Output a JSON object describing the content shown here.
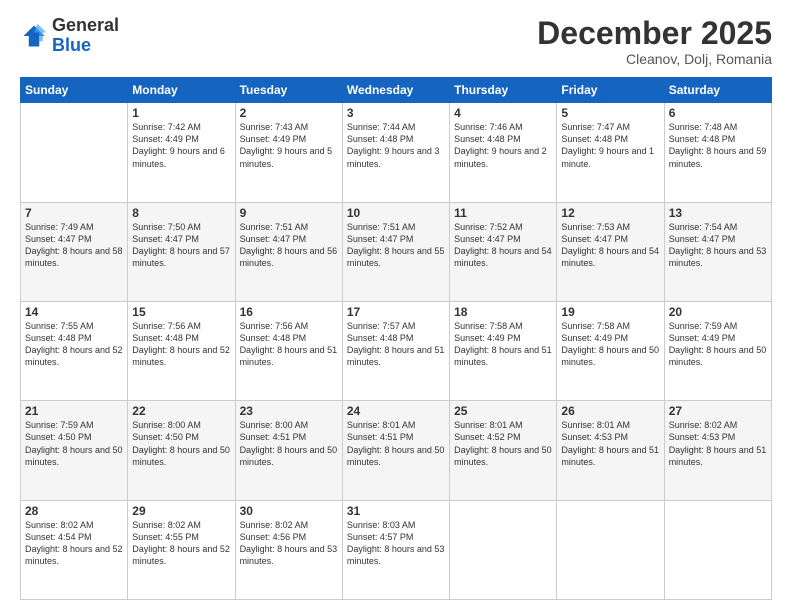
{
  "header": {
    "logo_general": "General",
    "logo_blue": "Blue",
    "month_title": "December 2025",
    "location": "Cleanov, Dolj, Romania"
  },
  "days_of_week": [
    "Sunday",
    "Monday",
    "Tuesday",
    "Wednesday",
    "Thursday",
    "Friday",
    "Saturday"
  ],
  "weeks": [
    [
      {
        "day": "",
        "sunrise": "",
        "sunset": "",
        "daylight": "",
        "empty": true
      },
      {
        "day": "1",
        "sunrise": "Sunrise: 7:42 AM",
        "sunset": "Sunset: 4:49 PM",
        "daylight": "Daylight: 9 hours and 6 minutes."
      },
      {
        "day": "2",
        "sunrise": "Sunrise: 7:43 AM",
        "sunset": "Sunset: 4:49 PM",
        "daylight": "Daylight: 9 hours and 5 minutes."
      },
      {
        "day": "3",
        "sunrise": "Sunrise: 7:44 AM",
        "sunset": "Sunset: 4:48 PM",
        "daylight": "Daylight: 9 hours and 3 minutes."
      },
      {
        "day": "4",
        "sunrise": "Sunrise: 7:46 AM",
        "sunset": "Sunset: 4:48 PM",
        "daylight": "Daylight: 9 hours and 2 minutes."
      },
      {
        "day": "5",
        "sunrise": "Sunrise: 7:47 AM",
        "sunset": "Sunset: 4:48 PM",
        "daylight": "Daylight: 9 hours and 1 minute."
      },
      {
        "day": "6",
        "sunrise": "Sunrise: 7:48 AM",
        "sunset": "Sunset: 4:48 PM",
        "daylight": "Daylight: 8 hours and 59 minutes."
      }
    ],
    [
      {
        "day": "7",
        "sunrise": "Sunrise: 7:49 AM",
        "sunset": "Sunset: 4:47 PM",
        "daylight": "Daylight: 8 hours and 58 minutes."
      },
      {
        "day": "8",
        "sunrise": "Sunrise: 7:50 AM",
        "sunset": "Sunset: 4:47 PM",
        "daylight": "Daylight: 8 hours and 57 minutes."
      },
      {
        "day": "9",
        "sunrise": "Sunrise: 7:51 AM",
        "sunset": "Sunset: 4:47 PM",
        "daylight": "Daylight: 8 hours and 56 minutes."
      },
      {
        "day": "10",
        "sunrise": "Sunrise: 7:51 AM",
        "sunset": "Sunset: 4:47 PM",
        "daylight": "Daylight: 8 hours and 55 minutes."
      },
      {
        "day": "11",
        "sunrise": "Sunrise: 7:52 AM",
        "sunset": "Sunset: 4:47 PM",
        "daylight": "Daylight: 8 hours and 54 minutes."
      },
      {
        "day": "12",
        "sunrise": "Sunrise: 7:53 AM",
        "sunset": "Sunset: 4:47 PM",
        "daylight": "Daylight: 8 hours and 54 minutes."
      },
      {
        "day": "13",
        "sunrise": "Sunrise: 7:54 AM",
        "sunset": "Sunset: 4:47 PM",
        "daylight": "Daylight: 8 hours and 53 minutes."
      }
    ],
    [
      {
        "day": "14",
        "sunrise": "Sunrise: 7:55 AM",
        "sunset": "Sunset: 4:48 PM",
        "daylight": "Daylight: 8 hours and 52 minutes."
      },
      {
        "day": "15",
        "sunrise": "Sunrise: 7:56 AM",
        "sunset": "Sunset: 4:48 PM",
        "daylight": "Daylight: 8 hours and 52 minutes."
      },
      {
        "day": "16",
        "sunrise": "Sunrise: 7:56 AM",
        "sunset": "Sunset: 4:48 PM",
        "daylight": "Daylight: 8 hours and 51 minutes."
      },
      {
        "day": "17",
        "sunrise": "Sunrise: 7:57 AM",
        "sunset": "Sunset: 4:48 PM",
        "daylight": "Daylight: 8 hours and 51 minutes."
      },
      {
        "day": "18",
        "sunrise": "Sunrise: 7:58 AM",
        "sunset": "Sunset: 4:49 PM",
        "daylight": "Daylight: 8 hours and 51 minutes."
      },
      {
        "day": "19",
        "sunrise": "Sunrise: 7:58 AM",
        "sunset": "Sunset: 4:49 PM",
        "daylight": "Daylight: 8 hours and 50 minutes."
      },
      {
        "day": "20",
        "sunrise": "Sunrise: 7:59 AM",
        "sunset": "Sunset: 4:49 PM",
        "daylight": "Daylight: 8 hours and 50 minutes."
      }
    ],
    [
      {
        "day": "21",
        "sunrise": "Sunrise: 7:59 AM",
        "sunset": "Sunset: 4:50 PM",
        "daylight": "Daylight: 8 hours and 50 minutes."
      },
      {
        "day": "22",
        "sunrise": "Sunrise: 8:00 AM",
        "sunset": "Sunset: 4:50 PM",
        "daylight": "Daylight: 8 hours and 50 minutes."
      },
      {
        "day": "23",
        "sunrise": "Sunrise: 8:00 AM",
        "sunset": "Sunset: 4:51 PM",
        "daylight": "Daylight: 8 hours and 50 minutes."
      },
      {
        "day": "24",
        "sunrise": "Sunrise: 8:01 AM",
        "sunset": "Sunset: 4:51 PM",
        "daylight": "Daylight: 8 hours and 50 minutes."
      },
      {
        "day": "25",
        "sunrise": "Sunrise: 8:01 AM",
        "sunset": "Sunset: 4:52 PM",
        "daylight": "Daylight: 8 hours and 50 minutes."
      },
      {
        "day": "26",
        "sunrise": "Sunrise: 8:01 AM",
        "sunset": "Sunset: 4:53 PM",
        "daylight": "Daylight: 8 hours and 51 minutes."
      },
      {
        "day": "27",
        "sunrise": "Sunrise: 8:02 AM",
        "sunset": "Sunset: 4:53 PM",
        "daylight": "Daylight: 8 hours and 51 minutes."
      }
    ],
    [
      {
        "day": "28",
        "sunrise": "Sunrise: 8:02 AM",
        "sunset": "Sunset: 4:54 PM",
        "daylight": "Daylight: 8 hours and 52 minutes."
      },
      {
        "day": "29",
        "sunrise": "Sunrise: 8:02 AM",
        "sunset": "Sunset: 4:55 PM",
        "daylight": "Daylight: 8 hours and 52 minutes."
      },
      {
        "day": "30",
        "sunrise": "Sunrise: 8:02 AM",
        "sunset": "Sunset: 4:56 PM",
        "daylight": "Daylight: 8 hours and 53 minutes."
      },
      {
        "day": "31",
        "sunrise": "Sunrise: 8:03 AM",
        "sunset": "Sunset: 4:57 PM",
        "daylight": "Daylight: 8 hours and 53 minutes."
      },
      {
        "day": "",
        "sunrise": "",
        "sunset": "",
        "daylight": "",
        "empty": true
      },
      {
        "day": "",
        "sunrise": "",
        "sunset": "",
        "daylight": "",
        "empty": true
      },
      {
        "day": "",
        "sunrise": "",
        "sunset": "",
        "daylight": "",
        "empty": true
      }
    ]
  ]
}
